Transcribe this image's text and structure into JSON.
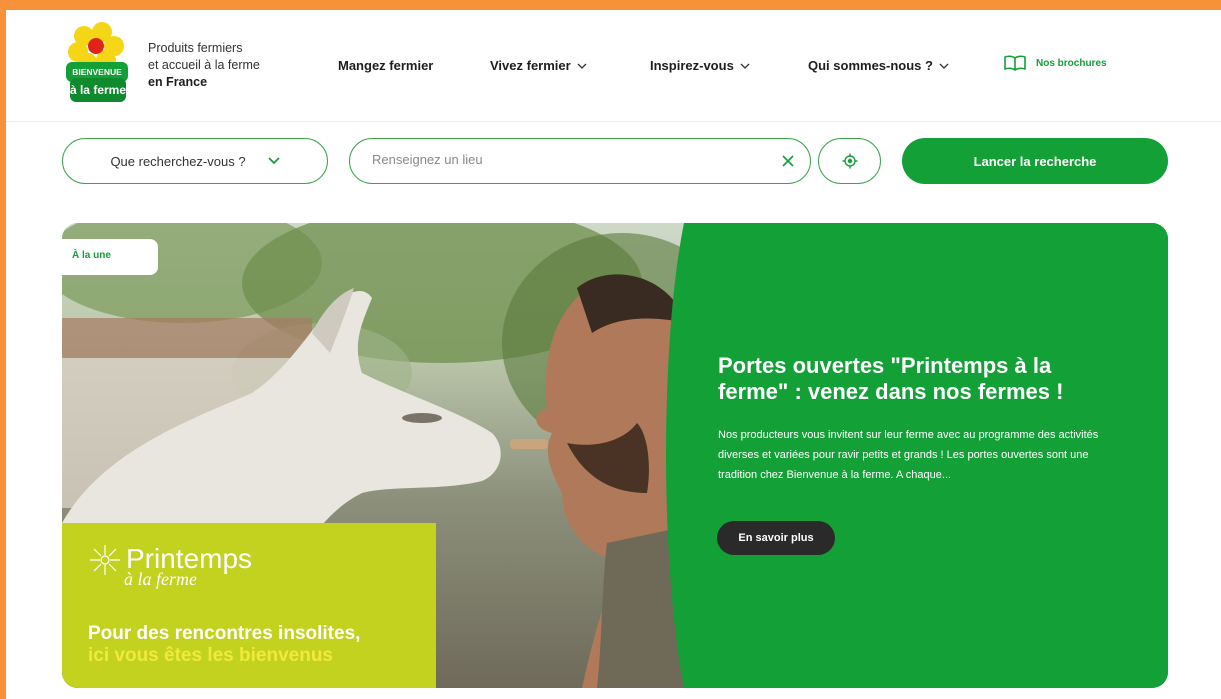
{
  "colors": {
    "frame": "#f7913a",
    "brand_green": "#13a037",
    "promo_lime": "#c3d21f",
    "promo_yellow": "#f0ea3a",
    "cta_dark": "#2a2a2a"
  },
  "header": {
    "logo_text_line1": "BIENVENUE",
    "logo_text_line2": "à la ferme",
    "tagline_line1": "Produits fermiers",
    "tagline_line2": "et accueil à la ferme",
    "tagline_line3": "en France",
    "nav": [
      {
        "label": "Mangez fermier",
        "has_dropdown": false
      },
      {
        "label": "Vivez fermier",
        "has_dropdown": true
      },
      {
        "label": "Inspirez-vous",
        "has_dropdown": true
      },
      {
        "label": "Qui sommes-nous ?",
        "has_dropdown": true
      }
    ],
    "brochures_label": "Nos brochures",
    "brochures_icon": "open-book-icon"
  },
  "search": {
    "category_label": "Que recherchez-vous ?",
    "location_placeholder": "Renseignez un lieu",
    "location_value": "",
    "submit_label": "Lancer la recherche"
  },
  "hero": {
    "badge": "À la une",
    "promo_title": "Printemps",
    "promo_subtitle": "à la ferme",
    "promo_line1": "Pour des rencontres insolites,",
    "promo_line2": "ici vous êtes les bienvenus",
    "title": "Portes ouvertes \"Printemps à la ferme\" : venez dans nos fermes !",
    "description": "Nos producteurs vous invitent sur leur ferme avec au programme des activités diverses et variées pour ravir petits et grands ! Les portes ouvertes sont une tradition chez Bienvenue à la ferme. A chaque...",
    "cta_label": "En savoir plus"
  }
}
